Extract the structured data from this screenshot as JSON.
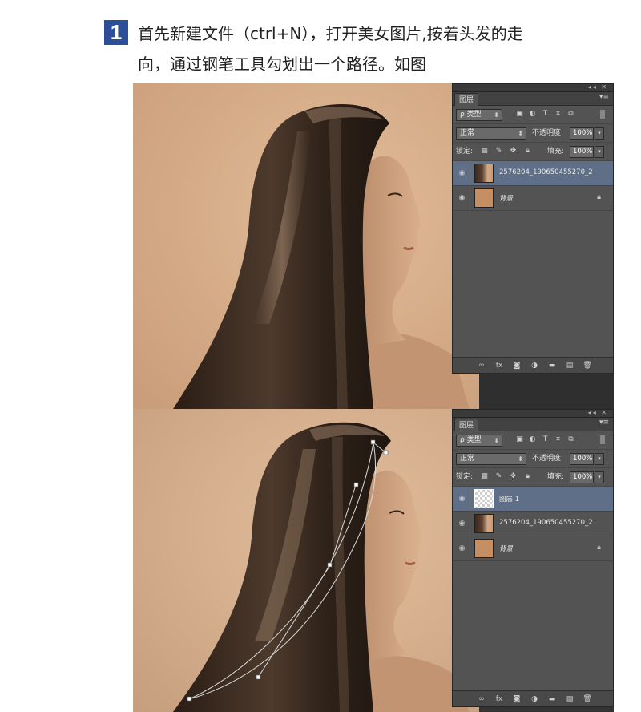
{
  "step": {
    "number": "1",
    "line1": "首先新建文件（ctrl+N），打开美女图片,按着头发的走",
    "line2": "向，通过钢笔工具勾划出一个路径。如图"
  },
  "panel_common": {
    "collapse_glyph": "◂◂ ✕",
    "tab_label": "图层",
    "menu_glyph": "▾≡",
    "filter_label": "ρ 类型",
    "blend_mode": "正常",
    "opacity_label": "不透明度:",
    "opacity_value": "100%",
    "lock_label": "锁定:",
    "fill_label": "填充:",
    "fill_value": "100%"
  },
  "panel1": {
    "layers": [
      {
        "name": "2576204_190650455270_2",
        "active": true,
        "thumb": "photo"
      },
      {
        "name": "背景",
        "active": false,
        "thumb": "background",
        "locked": true
      }
    ]
  },
  "panel2": {
    "layers": [
      {
        "name": "图层 1",
        "active": true,
        "thumb": "transparent"
      },
      {
        "name": "2576204_190650455270_2",
        "active": false,
        "thumb": "photo"
      },
      {
        "name": "背景",
        "active": false,
        "thumb": "background",
        "locked": true
      }
    ]
  },
  "icons": {
    "eye": "eye-icon",
    "lock": "lock-icon",
    "link": "link-icon",
    "fx": "fx-icon",
    "mask": "mask-icon",
    "adjust": "adjustment-icon",
    "folder": "folder-icon",
    "new": "new-layer-icon",
    "trash": "trash-icon"
  },
  "colors": {
    "badge": "#2d4f9a",
    "panel": "#535353",
    "active_layer": "#5e6f87",
    "skin_bg": "#d7ae8a",
    "hair": "#3a2c22"
  }
}
